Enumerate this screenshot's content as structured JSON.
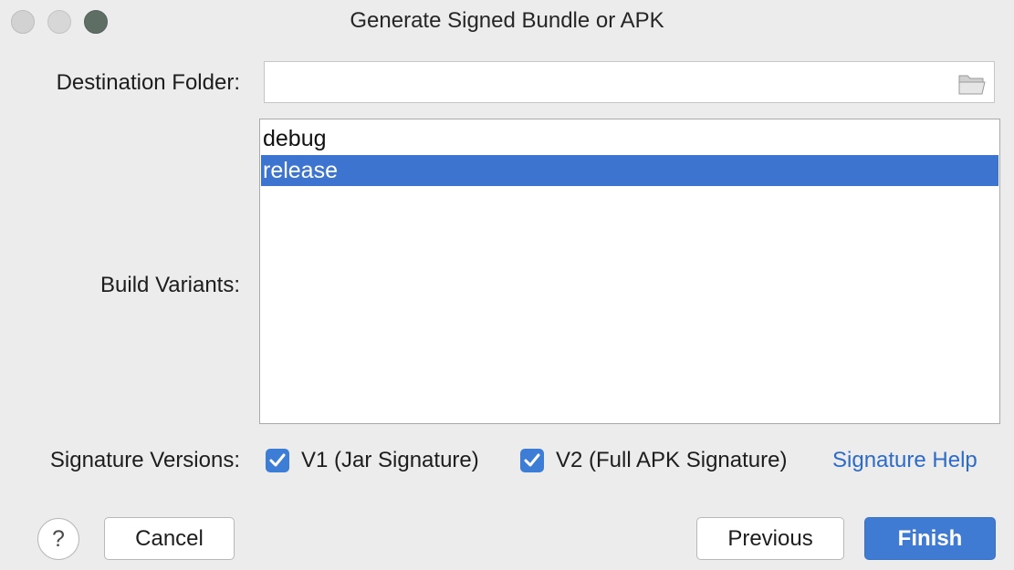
{
  "window": {
    "title": "Generate Signed Bundle or APK"
  },
  "destination": {
    "label": "Destination Folder:",
    "value": "",
    "placeholder": ""
  },
  "build_variants": {
    "label": "Build Variants:",
    "items": [
      {
        "label": "debug",
        "selected": false
      },
      {
        "label": "release",
        "selected": true
      }
    ]
  },
  "signature_versions": {
    "label": "Signature Versions:",
    "options": [
      {
        "label": "V1 (Jar Signature)",
        "checked": true
      },
      {
        "label": "V2 (Full APK Signature)",
        "checked": true
      }
    ],
    "help_link": "Signature Help"
  },
  "footer": {
    "help_symbol": "?",
    "cancel_label": "Cancel",
    "previous_label": "Previous",
    "finish_label": "Finish"
  },
  "colors": {
    "accent": "#3d74cf",
    "link": "#2d6bc8"
  },
  "icons": [
    "close-icon",
    "minimize-icon",
    "zoom-icon",
    "folder-icon",
    "checkmark-icon",
    "help-icon"
  ]
}
